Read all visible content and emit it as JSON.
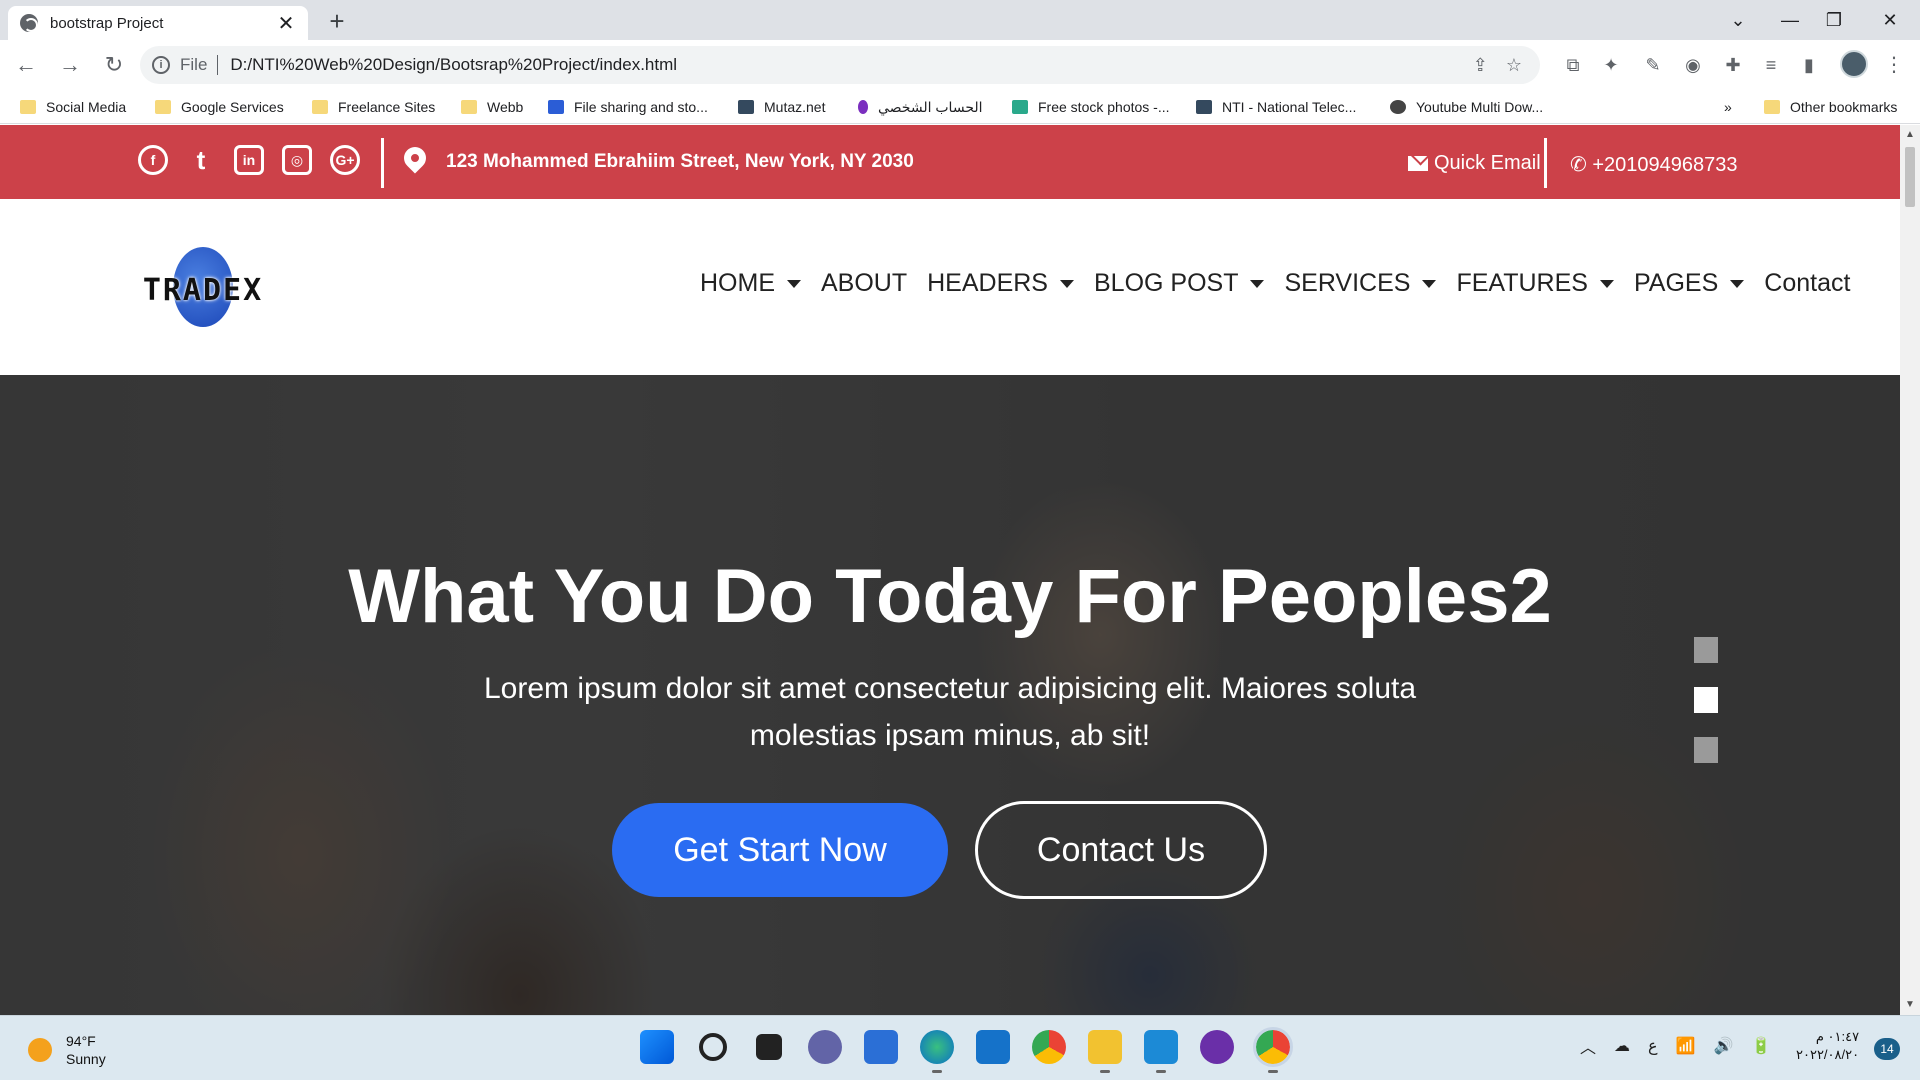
{
  "browser": {
    "tab_title": "bootstrap Project",
    "tab_close": "✕",
    "new_tab": "+",
    "window_controls": [
      "⌄",
      "—",
      "❐",
      "✕"
    ],
    "nav": {
      "back": "←",
      "forward": "→",
      "reload": "↻"
    },
    "omnibox": {
      "scheme": "File",
      "url": "D:/NTI%20Web%20Design/Bootsrap%20Project/index.html"
    },
    "bookmarks": [
      {
        "label": "Social Media",
        "icon": "folder-icon"
      },
      {
        "label": "Google Services",
        "icon": "folder-icon"
      },
      {
        "label": "Freelance Sites",
        "icon": "folder-icon"
      },
      {
        "label": "Webb",
        "icon": "folder-icon"
      },
      {
        "label": "File sharing and sto...",
        "icon": "file-share-icon"
      },
      {
        "label": "Mutaz.net",
        "icon": "mutaz-icon"
      },
      {
        "label": "الحساب الشخصي",
        "icon": "account-icon"
      },
      {
        "label": "Free stock photos -...",
        "icon": "stock-photo-icon"
      },
      {
        "label": "NTI - National Telec...",
        "icon": "nti-icon"
      },
      {
        "label": "Youtube Multi Dow...",
        "icon": "globe-icon"
      }
    ],
    "bookmarks_overflow": "»",
    "other_bookmarks": "Other bookmarks"
  },
  "topbar": {
    "socials": [
      "facebook-icon",
      "twitter-icon",
      "linkedin-icon",
      "instagram-icon",
      "google-plus-icon"
    ],
    "social_glyphs": [
      "f",
      "t",
      "in",
      "◎",
      "G+"
    ],
    "address": "123 Mohammed Ebrahiim Street, New York, NY 2030",
    "email_label": "Quick Email",
    "phone": "+201094968733",
    "phone_glyph": "✆",
    "bg_color": "#cc4149"
  },
  "navbar": {
    "logo": "TRADEX",
    "items": [
      {
        "label": "HOME",
        "dropdown": true
      },
      {
        "label": "ABOUT",
        "dropdown": false
      },
      {
        "label": "HEADERS",
        "dropdown": true
      },
      {
        "label": "BLOG POST",
        "dropdown": true
      },
      {
        "label": "SERVICES",
        "dropdown": true
      },
      {
        "label": "FEATURES",
        "dropdown": true
      },
      {
        "label": "PAGES",
        "dropdown": true
      },
      {
        "label": "Contact",
        "dropdown": false
      }
    ]
  },
  "hero": {
    "title": "What You Do Today For Peoples2",
    "lead": "Lorem ipsum dolor sit amet consectetur adipisicing elit. Maiores soluta molestias ipsam minus, ab sit!",
    "primary_button": "Get Start Now",
    "secondary_button": "Contact Us",
    "primary_color": "#2a6cf2",
    "slides": 3,
    "active_slide": 2
  },
  "taskbar": {
    "weather_temp": "94°F",
    "weather_desc": "Sunny",
    "apps": [
      "windows-start-icon",
      "search-icon",
      "task-view-icon",
      "teams-icon",
      "store-icon",
      "edge-icon",
      "mail-icon",
      "chrome-icon",
      "file-explorer-icon",
      "vscode-icon",
      "github-icon",
      "chrome-profile-icon"
    ],
    "tray_glyphs": [
      "︿",
      "☁",
      "ع",
      "📶",
      "🔊",
      "🔋"
    ],
    "time": "٠١:٤٧ م",
    "date": "٢٠٢٢/٠٨/٢٠",
    "notifications": "14"
  }
}
